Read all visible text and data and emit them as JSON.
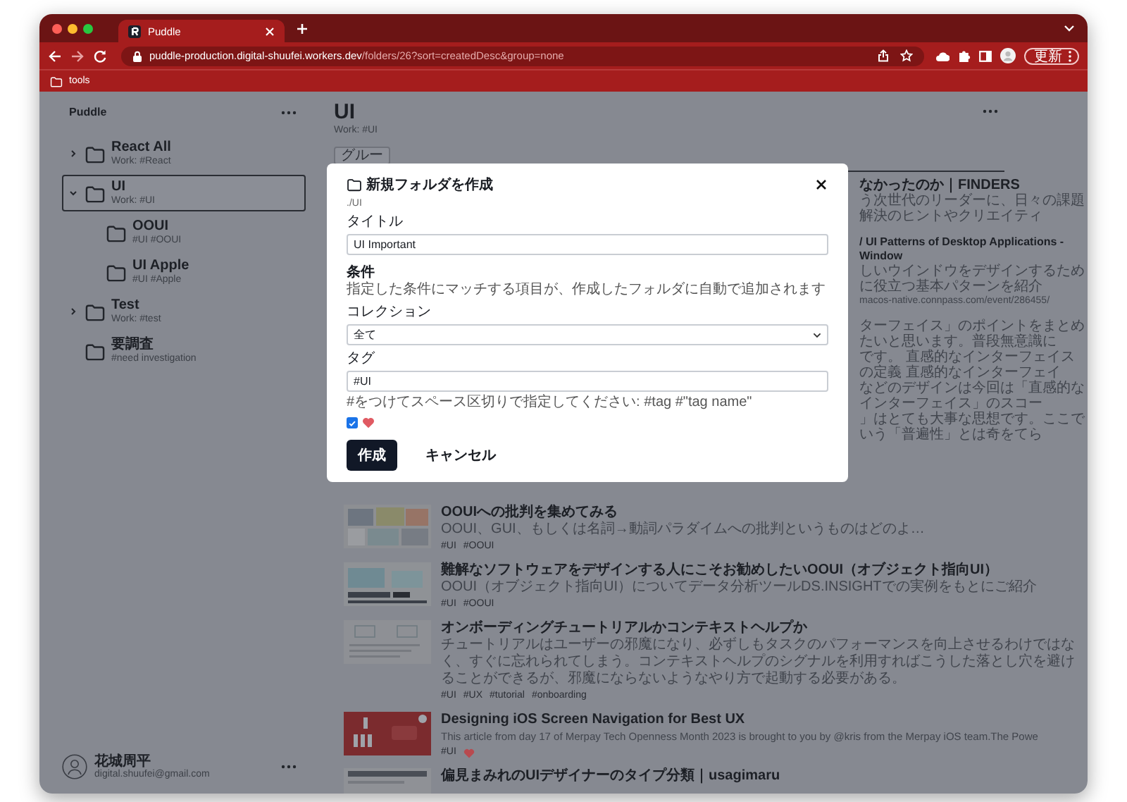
{
  "browser": {
    "tab": {
      "title": "Puddle",
      "selected": true
    },
    "url": {
      "host": "puddle-production.digital-shuufei.workers.dev",
      "path": "/folders/26?sort=createdDesc&group=none"
    },
    "bookmarks": [
      {
        "label": "tools"
      }
    ],
    "update_button": "更新"
  },
  "sidebar": {
    "title": "Puddle",
    "folders": [
      {
        "name": "React All",
        "subtitle": "Work: #React",
        "expanded": false,
        "selected": false
      },
      {
        "name": "UI",
        "subtitle": "Work: #UI",
        "expanded": true,
        "selected": true,
        "children": [
          {
            "name": "OOUI",
            "subtitle": "#UI #OOUI",
            "selected": false
          },
          {
            "name": "UI Apple",
            "subtitle": "#UI #Apple",
            "selected": false
          }
        ]
      },
      {
        "name": "Test",
        "subtitle": "Work: #test",
        "expanded": false,
        "selected": false
      },
      {
        "name": "要調査",
        "subtitle": "#need investigation",
        "selected": false
      }
    ],
    "user": {
      "name": "花城周平",
      "email": "digital.shuufei@gmail.com"
    }
  },
  "main": {
    "title": "UI",
    "subtitle": "Work: #UI",
    "group_button": "グルー",
    "articles": [
      {
        "kind": "partial",
        "lines": [
          {
            "kind": "title",
            "text": "なかったのか｜FINDERS"
          },
          {
            "kind": "description",
            "text": "う次世代のリーダーに、日々の課題解決のヒントやクリエイティ"
          }
        ]
      },
      {
        "kind": "partial",
        "lines": [
          {
            "kind": "title",
            "text": "/ UI Patterns of Desktop Applications - Window"
          },
          {
            "kind": "description",
            "text": "しいウインドウをデザインするために役立つ基本パターンを紹介"
          },
          {
            "kind": "link",
            "text": "macos-native.connpass.com/event/286455/"
          }
        ]
      },
      {
        "kind": "partial",
        "lines": [
          {
            "kind": "description",
            "text": "ターフェイス」のポイントをまとめたいと思います。普段無意識に"
          },
          {
            "kind": "description",
            "text": "です。 直感的なインターフェイスの定義 直感的なインターフェイ"
          },
          {
            "kind": "description",
            "text": "などのデザインは今回は「直感的なインターフェイス」のスコー"
          },
          {
            "kind": "description",
            "text": "」はとても大事な思想です。ここでいう「普遍性」とは奇をてら"
          }
        ]
      },
      {
        "kind": "full",
        "title": "OOUIへの批判を集めてみる",
        "description": "OOUI、GUI、もしくは名詞→動詞パラダイムへの批判というものはどのよ…",
        "tags": [
          "#UI",
          "#OOUI"
        ],
        "liked": false
      },
      {
        "kind": "full",
        "title": "難解なソフトウェアをデザインする人にこそお勧めしたいOOUI（オブジェクト指向UI）",
        "description": "OOUI（オブジェクト指向UI）についてデータ分析ツールDS.INSIGHTでの実例をもとにご紹介",
        "tags": [
          "#UI",
          "#OOUI"
        ],
        "liked": false
      },
      {
        "kind": "full",
        "title": "オンボーディングチュートリアルかコンテキストヘルプか",
        "description": "チュートリアルはユーザーの邪魔になり、必ずしもタスクのパフォーマンスを向上させるわけではなく、すぐに忘れられてしまう。コンテキストヘルプのシグナルを利用すればこうした落とし穴を避けることができるが、邪魔にならないようなやり方で起動する必要がある。",
        "tags": [
          "#UI",
          "#UX",
          "#tutorial",
          "#onboarding"
        ],
        "liked": false
      },
      {
        "kind": "full",
        "title": "Designing iOS Screen Navigation for Best UX",
        "description": "This article from day 17 of Merpay Tech Openness Month 2023 is brought to you by @kris from the Merpay iOS team.The Powe",
        "tags": [
          "#UI"
        ],
        "liked": true
      },
      {
        "kind": "full",
        "title": "偏見まみれのUIデザイナーのタイプ分類｜usagimaru"
      }
    ]
  },
  "dialog": {
    "title": "新規フォルダを作成",
    "path": "./UI",
    "title_field": {
      "label": "タイトル",
      "value": "UI Important"
    },
    "conditions_heading": "条件",
    "conditions_hint": "指定した条件にマッチする項目が、作成したフォルダに自動で追加されます",
    "collection": {
      "label": "コレクション",
      "value": "全て"
    },
    "tags": {
      "label": "タグ",
      "value": "#UI",
      "hint": "#をつけてスペース区切りで指定してください: #tag #\"tag name\""
    },
    "liked_filter": {
      "checked": true
    },
    "buttons": [
      {
        "label": "作成",
        "kind": "primary"
      },
      {
        "label": "キャンセル",
        "kind": "plain"
      }
    ]
  }
}
